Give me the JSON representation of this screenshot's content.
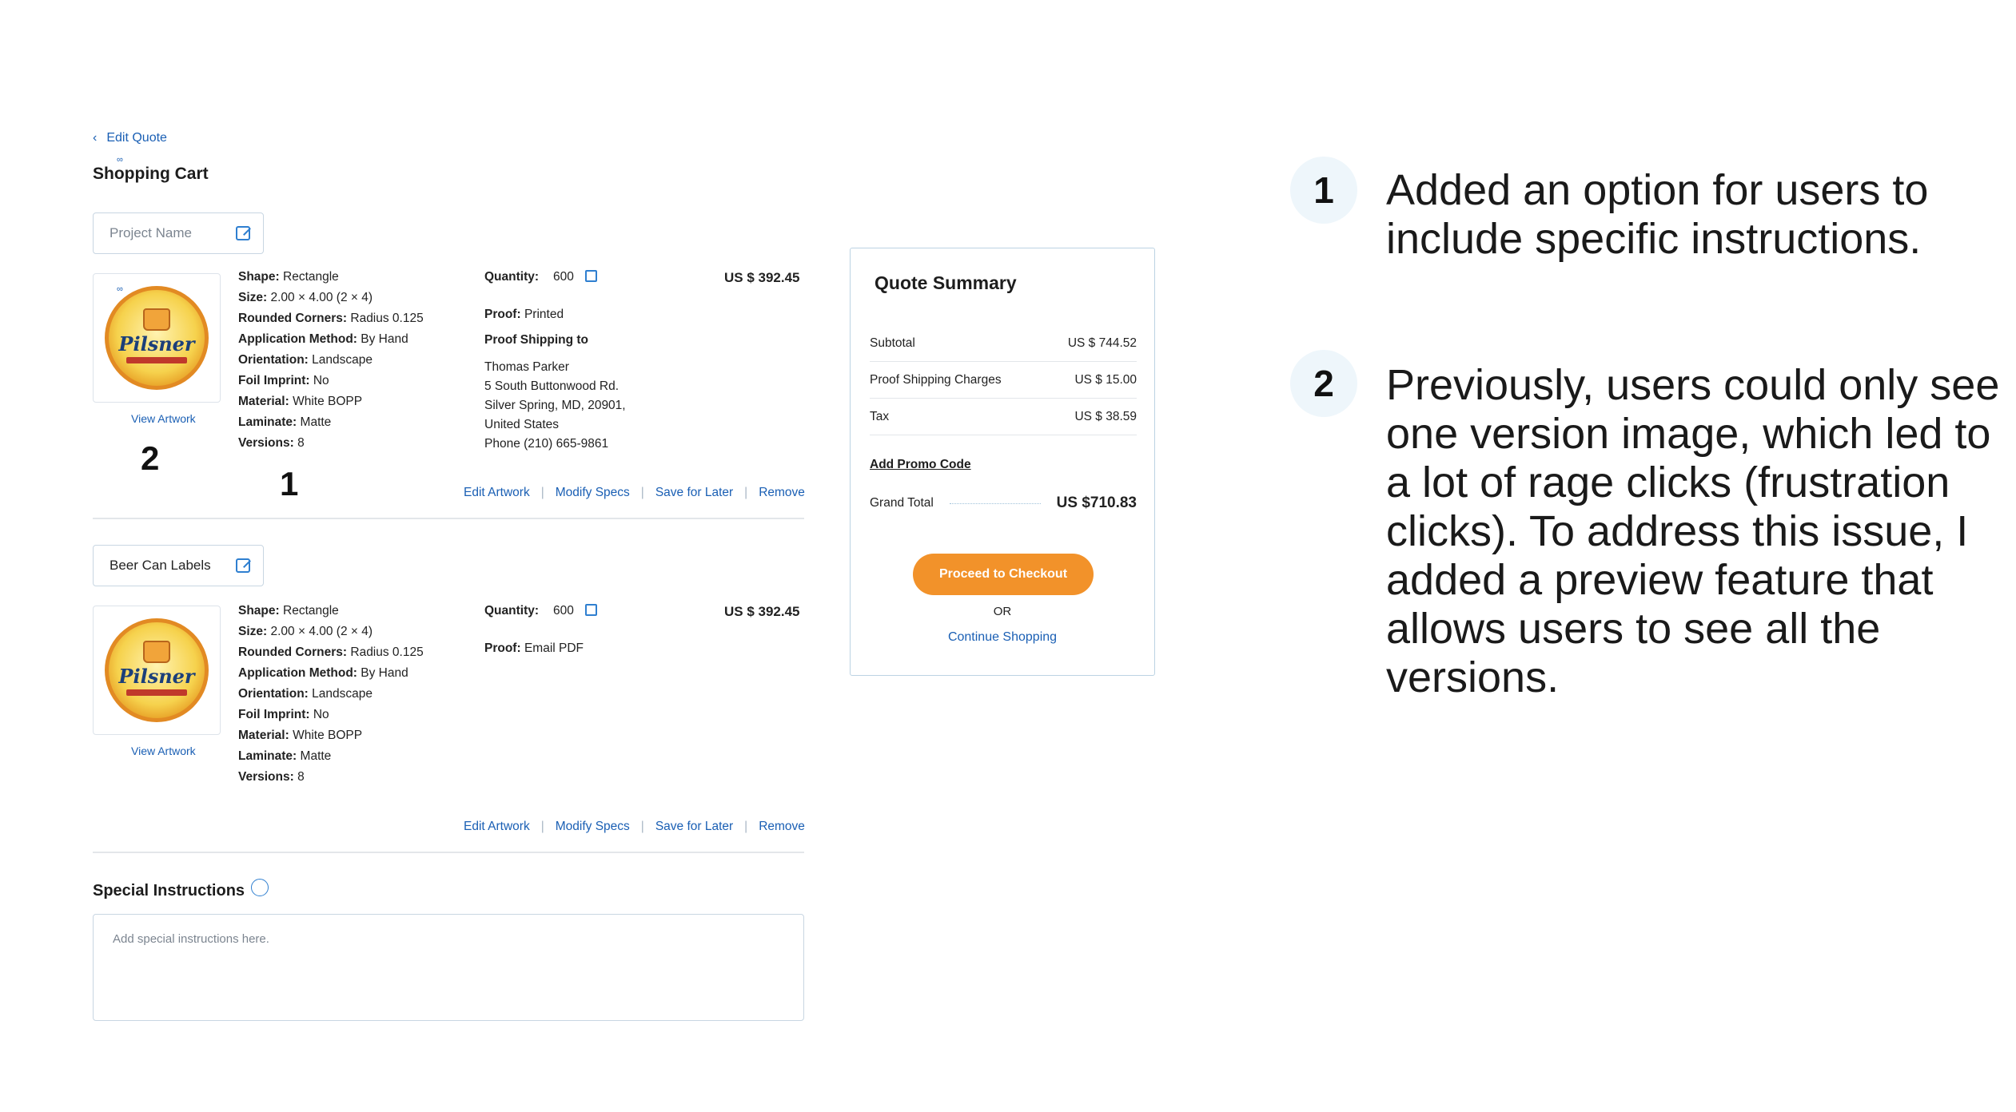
{
  "header": {
    "back_label": "Edit Quote",
    "title": "Shopping Cart",
    "mark": "∞"
  },
  "items": [
    {
      "name": "",
      "name_placeholder": "Project Name",
      "brand": "Pilsner",
      "view_artwork": "View Artwork",
      "specs": {
        "shape_label": "Shape:",
        "shape": "Rectangle",
        "size_label": "Size:",
        "size": "2.00 × 4.00 (2 × 4)",
        "corners_label": "Rounded Corners:",
        "corners": "Radius 0.125",
        "method_label": "Application Method:",
        "method": "By Hand",
        "orientation_label": "Orientation:",
        "orientation": "Landscape",
        "foil_label": "Foil Imprint:",
        "foil": "No",
        "material_label": "Material:",
        "material": "White BOPP",
        "laminate_label": "Laminate:",
        "laminate": "Matte",
        "versions_label": "Versions:",
        "versions": "8"
      },
      "quantity_label": "Quantity:",
      "quantity": "600",
      "price": "US $ 392.45",
      "proof_label": "Proof:",
      "proof": "Printed",
      "shipping_label": "Proof Shipping to",
      "address": [
        "Thomas Parker",
        "5 South Buttonwood Rd.",
        "Silver Spring, MD, 20901,",
        "United States",
        "Phone (210) 665-9861"
      ]
    },
    {
      "name": "Beer Can Labels",
      "brand": "Pilsner",
      "view_artwork": "View Artwork",
      "specs": {
        "shape_label": "Shape:",
        "shape": "Rectangle",
        "size_label": "Size:",
        "size": "2.00 × 4.00 (2 × 4)",
        "corners_label": "Rounded Corners:",
        "corners": "Radius 0.125",
        "method_label": "Application Method:",
        "method": "By Hand",
        "orientation_label": "Orientation:",
        "orientation": "Landscape",
        "foil_label": "Foil Imprint:",
        "foil": "No",
        "material_label": "Material:",
        "material": "White BOPP",
        "laminate_label": "Laminate:",
        "laminate": "Matte",
        "versions_label": "Versions:",
        "versions": "8"
      },
      "quantity_label": "Quantity:",
      "quantity": "600",
      "price": "US $ 392.45",
      "proof_label": "Proof:",
      "proof": "Email PDF"
    }
  ],
  "actions": {
    "edit_artwork": "Edit Artwork",
    "modify_specs": "Modify Specs",
    "save_later": "Save for Later",
    "remove": "Remove",
    "separator": "|"
  },
  "markers": {
    "one": "1",
    "two": "2"
  },
  "special": {
    "title": "Special Instructions",
    "placeholder": "Add special instructions here."
  },
  "summary": {
    "title": "Quote Summary",
    "subtotal_label": "Subtotal",
    "subtotal": "US $  744.52",
    "shipping_label": "Proof Shipping Charges",
    "shipping": "US $ 15.00",
    "tax_label": "Tax",
    "tax": "US $ 38.59",
    "promo": "Add Promo Code",
    "grand_label": "Grand Total",
    "grand": "US $710.83",
    "checkout": "Proceed to Checkout",
    "or": "OR",
    "continue": "Continue Shopping",
    "accent_color": "#f2922a"
  },
  "notes": [
    {
      "number": "1",
      "text": "Added an option for users to include specific instructions."
    },
    {
      "number": "2",
      "text": "Previously, users could only see one version image, which led to a lot of rage clicks (frustration clicks). To address this issue, I added a preview feature that allows users to see all the versions."
    }
  ]
}
